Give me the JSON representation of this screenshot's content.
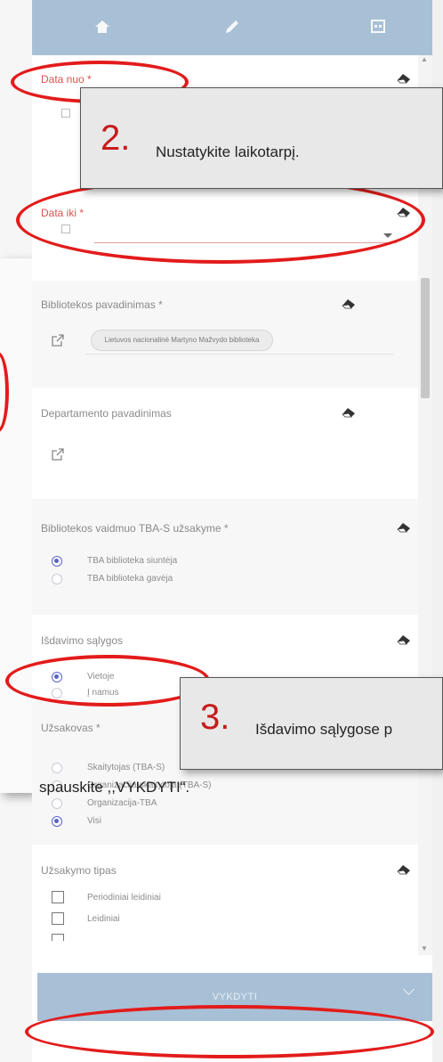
{
  "toolbar": {
    "icons": [
      "home-icon",
      "pencil-icon",
      "calendar-icon"
    ]
  },
  "fields": {
    "date_from": {
      "label": "Data nuo *"
    },
    "date_to": {
      "label": "Data iki *"
    },
    "library_name": {
      "label": "Bibliotekos pavadinimas *",
      "chip": "Lietuvos nacionalinė Martyno Mažvydo biblioteka"
    },
    "department_name": {
      "label": "Departamento pavadinimas"
    },
    "library_role": {
      "label": "Bibliotekos vaidmuo TBA-S užsakyme *",
      "options": [
        "TBA biblioteka siuntėja",
        "TBA biblioteka gavėja"
      ],
      "selected_index": 0
    },
    "issue_conditions": {
      "label": "Išdavimo sąlygos",
      "options": [
        "Vietoje",
        "Į namus"
      ],
      "selected_index": 0
    },
    "customer": {
      "label": "Užsakovas *",
      "options": [
        "Skaitytojas (TBA-S)",
        "Organizacija-skaitytoja (TBA-S)",
        "Organizacija-TBA",
        "Visi"
      ],
      "selected_index": 3
    },
    "order_type": {
      "label": "Užsakymo tipas",
      "options": [
        "Periodiniai leidiniai",
        "Leidiniai"
      ]
    }
  },
  "footer": {
    "execute_label": "VYKDYTI"
  },
  "annotations": {
    "step2": {
      "number": "2.",
      "text": "Nustatykite laikotarpį."
    },
    "step3": {
      "number": "3.",
      "text_line1": "Išdavimo sąlygose p",
      "text_line2": "spauskite ,,VYKDYTI“."
    }
  },
  "colors": {
    "toolbar": "#a8c0d6",
    "required_label": "#d9534f",
    "radio_selected": "#5a63c8",
    "annotation_red": "#e31b1b"
  }
}
